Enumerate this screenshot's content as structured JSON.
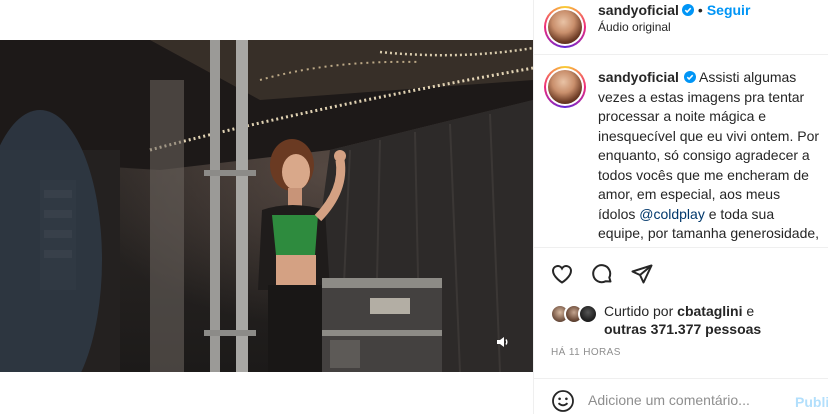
{
  "post": {
    "username": "sandyoficial",
    "follow_label": "Seguir",
    "dot": "•",
    "audio": "Áudio original"
  },
  "caption": {
    "username": "sandyoficial",
    "text_before": "Assisti algumas vezes a estas imagens pra tentar processar a noite mágica e inesquecível que eu vivi ontem. Por enquanto, só consigo agradecer a todos vocês que me encheram de amor, em especial, aos meus ídolos ",
    "mention": "@coldplay",
    "text_after": " e toda sua equipe, por tamanha generosidade, simpatia, profissionalismo e carinho... Vou"
  },
  "likes": {
    "prefix": "Curtido por",
    "user": "cbataglini",
    "conj": "e",
    "others": "outras 371.377 pessoas"
  },
  "time": "HÁ 11 HORAS",
  "comment": {
    "placeholder": "Adicione um comentário...",
    "publish_label": "Publi"
  },
  "icons": {
    "verified": "verified-badge-icon",
    "like": "heart-icon",
    "comment": "comment-icon",
    "share": "send-icon",
    "emoji": "emoji-icon",
    "mute": "speaker-icon"
  },
  "colors": {
    "accent": "#0095f6",
    "mention": "#00376b",
    "muted": "#8e8e8e",
    "publish_disabled": "#b2dffc"
  }
}
